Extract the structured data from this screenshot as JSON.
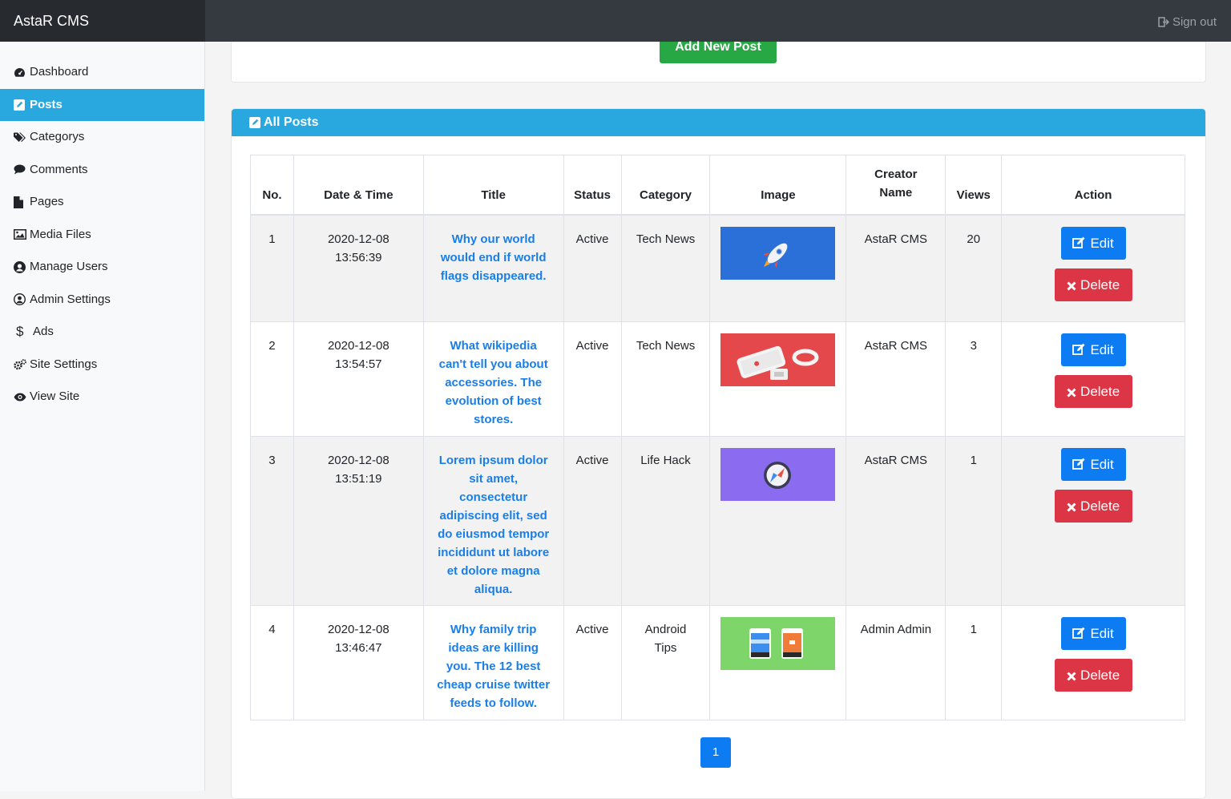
{
  "app": {
    "brand": "AstaR CMS",
    "sign_out": "Sign out"
  },
  "sidebar": {
    "items": [
      {
        "label": "Dashboard",
        "icon": "dashboard-icon"
      },
      {
        "label": "Posts",
        "icon": "edit-square-icon",
        "active": true
      },
      {
        "label": "Categorys",
        "icon": "tags-icon"
      },
      {
        "label": "Comments",
        "icon": "comment-icon"
      },
      {
        "label": "Pages",
        "icon": "file-icon"
      },
      {
        "label": "Media Files",
        "icon": "image-icon"
      },
      {
        "label": "Manage Users",
        "icon": "user-circle-icon"
      },
      {
        "label": "Admin Settings",
        "icon": "user-circle-icon"
      },
      {
        "label": "Ads",
        "icon": "dollar-icon"
      },
      {
        "label": "Site Settings",
        "icon": "cogs-icon"
      },
      {
        "label": "View Site",
        "icon": "eye-icon"
      }
    ]
  },
  "main": {
    "add_button": "Add New Post",
    "card_title": "All Posts",
    "columns": [
      "No.",
      "Date & Time",
      "Title",
      "Status",
      "Category",
      "Image",
      "Creator Name",
      "Views",
      "Action"
    ],
    "rows": [
      {
        "no": "1",
        "date": "2020-12-08",
        "time": "13:56:39",
        "title": "Why our world would end if world flags disappeared.",
        "status": "Active",
        "category": "Tech News",
        "creator": "AstaR CMS",
        "views": "20"
      },
      {
        "no": "2",
        "date": "2020-12-08",
        "time": "13:54:57",
        "title": "What wikipedia can't tell you about accessories. The evolution of best stores.",
        "status": "Active",
        "category": "Tech News",
        "creator": "AstaR CMS",
        "views": "3"
      },
      {
        "no": "3",
        "date": "2020-12-08",
        "time": "13:51:19",
        "title": "Lorem ipsum dolor sit amet, consectetur adipiscing elit, sed do eiusmod tempor incididunt ut labore et dolore magna aliqua.",
        "status": "Active",
        "category": "Life Hack",
        "creator": "AstaR CMS",
        "views": "1"
      },
      {
        "no": "4",
        "date": "2020-12-08",
        "time": "13:46:47",
        "title": "Why family trip ideas are killing you. The 12 best cheap cruise twitter feeds to follow.",
        "status": "Active",
        "category": "Android Tips",
        "creator": "Admin Admin",
        "views": "1"
      }
    ],
    "edit_label": "Edit",
    "delete_label": "Delete",
    "pagination": [
      "1"
    ]
  },
  "colors": {
    "accent": "#29a8e0",
    "topbar": "#343a40",
    "success": "#28a745",
    "primary": "#0d7bf2",
    "danger": "#dc3545"
  }
}
